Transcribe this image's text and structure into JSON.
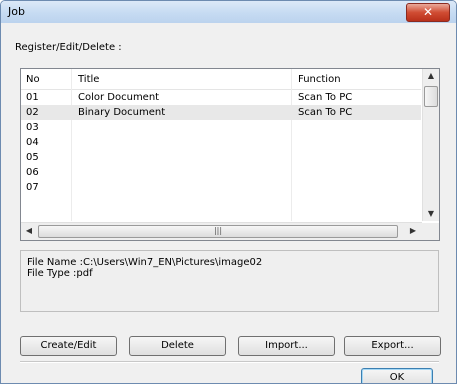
{
  "window": {
    "title": "Job",
    "close_label": "✕"
  },
  "section_label": "Register/Edit/Delete :",
  "list": {
    "columns": [
      "No",
      "Title",
      "Function"
    ],
    "rows": [
      {
        "no": "01",
        "title": "Color Document",
        "function": "Scan To PC"
      },
      {
        "no": "02",
        "title": "Binary Document",
        "function": "Scan To PC"
      },
      {
        "no": "03",
        "title": "",
        "function": ""
      },
      {
        "no": "04",
        "title": "",
        "function": ""
      },
      {
        "no": "05",
        "title": "",
        "function": ""
      },
      {
        "no": "06",
        "title": "",
        "function": ""
      },
      {
        "no": "07",
        "title": "",
        "function": ""
      }
    ]
  },
  "info": {
    "file_name": "File Name :C:\\Users\\Win7_EN\\Pictures\\image02",
    "file_type": "File Type :pdf"
  },
  "buttons": {
    "create_edit": "Create/Edit",
    "delete": "Delete",
    "import": "Import...",
    "export": "Export...",
    "ok": "OK"
  },
  "icons": {
    "close": "close-icon",
    "up": "scroll-up-icon",
    "down": "scroll-down-icon",
    "left": "scroll-left-icon",
    "right": "scroll-right-icon"
  }
}
